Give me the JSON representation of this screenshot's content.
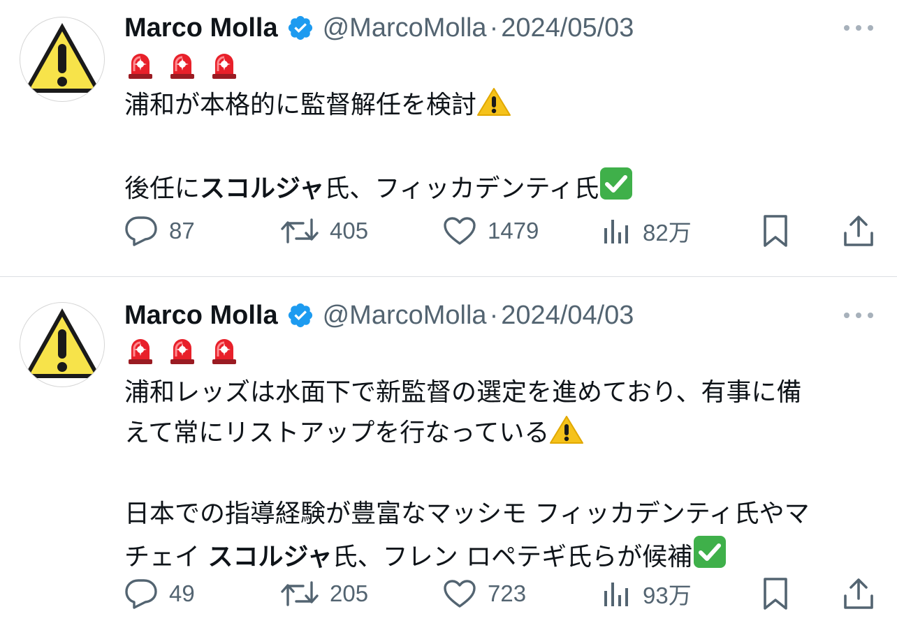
{
  "tweets": [
    {
      "name": "Marco Molla",
      "handle": "@MarcoMolla",
      "separator": "·",
      "date": "2024/05/03",
      "siren_count": 3,
      "body_lines": [
        {
          "segments": [
            {
              "text": "浦和が本格的に監督解任を検討"
            }
          ],
          "trailing_icon": "warning-emoji"
        },
        {
          "blank": true
        },
        {
          "segments": [
            {
              "text": "後任に"
            },
            {
              "text": "スコルジャ",
              "bold": true
            },
            {
              "text": "氏、フィッカデンティ氏"
            }
          ],
          "trailing_icon": "check-emoji"
        }
      ],
      "stats": {
        "replies": "87",
        "retweets": "405",
        "likes": "1479",
        "views": "82万"
      }
    },
    {
      "name": "Marco Molla",
      "handle": "@MarcoMolla",
      "separator": "·",
      "date": "2024/04/03",
      "siren_count": 3,
      "body_lines": [
        {
          "segments": [
            {
              "text": "浦和レッズは水面下で新監督の選定を進めており、有事に備"
            }
          ]
        },
        {
          "segments": [
            {
              "text": "えて常にリストアップを行なっている"
            }
          ],
          "trailing_icon": "warning-emoji"
        },
        {
          "blank": true
        },
        {
          "segments": [
            {
              "text": "日本での指導経験が豊富なマッシモ フィッカデンティ氏やマ"
            }
          ]
        },
        {
          "segments": [
            {
              "text": "チェイ "
            },
            {
              "text": "スコルジャ",
              "bold": true
            },
            {
              "text": "氏、フレン ロペテギ氏らが候補"
            }
          ],
          "trailing_icon": "check-emoji"
        }
      ],
      "stats": {
        "replies": "49",
        "retweets": "205",
        "likes": "723",
        "views": "93万"
      }
    }
  ],
  "icons": {
    "avatar": "warning-sign-avatar",
    "verified": "verified-badge-icon",
    "more": "more-options-icon",
    "reply": "reply-icon",
    "retweet": "retweet-icon",
    "like": "like-icon",
    "views": "views-icon",
    "bookmark": "bookmark-icon",
    "share": "share-icon"
  },
  "colors": {
    "name": "#0f1419",
    "secondary": "#536471",
    "verified": "#1d9bf0",
    "divider": "#dcdfe3",
    "avatar_yellow": "#f7e34a",
    "siren_red": "#e8202a",
    "check_green": "#3fb04a",
    "warning_yellow": "#f5c21b"
  }
}
